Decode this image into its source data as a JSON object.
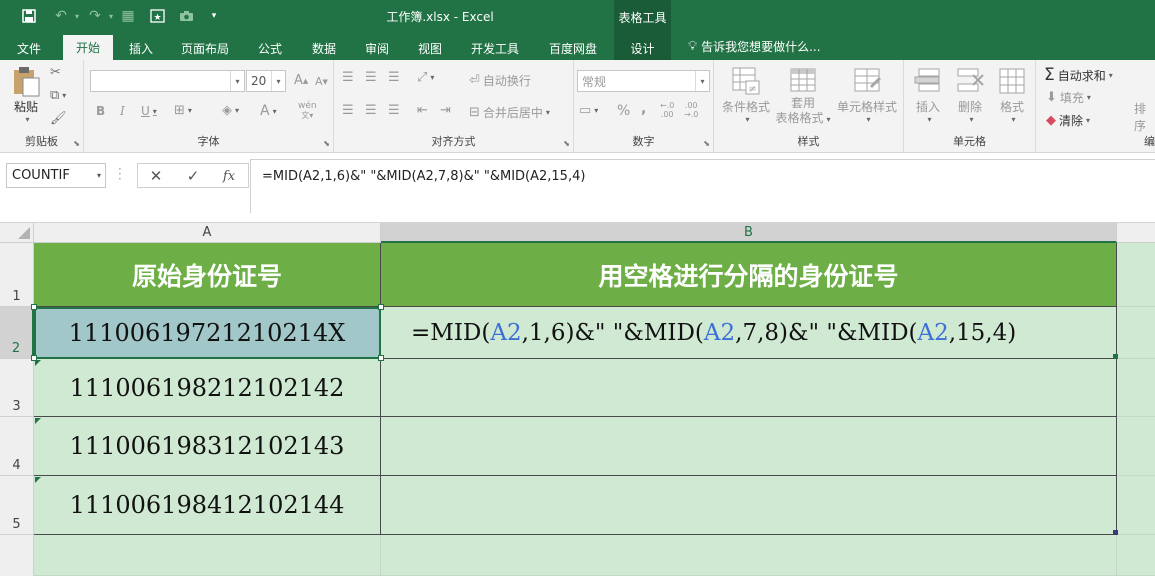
{
  "window": {
    "title": "工作簿.xlsx - Excel",
    "context_group": "表格工具"
  },
  "tabs": [
    {
      "label": "文件"
    },
    {
      "label": "开始"
    },
    {
      "label": "插入"
    },
    {
      "label": "页面布局"
    },
    {
      "label": "公式"
    },
    {
      "label": "数据"
    },
    {
      "label": "审阅"
    },
    {
      "label": "视图"
    },
    {
      "label": "开发工具"
    },
    {
      "label": "百度网盘"
    },
    {
      "label": "设计"
    }
  ],
  "tell_me": "告诉我您想要做什么...",
  "ribbon": {
    "clipboard": {
      "label": "剪贴板",
      "paste": "粘贴"
    },
    "font": {
      "label": "字体",
      "font_name": "",
      "font_size": "20",
      "bold": "B",
      "italic": "I",
      "underline": "U",
      "grow": "A",
      "shrink": "A"
    },
    "alignment": {
      "label": "对齐方式",
      "wrap": "自动换行",
      "merge": "合并后居中"
    },
    "number": {
      "label": "数字",
      "format": "常规",
      "percent": "%",
      "comma": ","
    },
    "styles": {
      "label": "样式",
      "conditional": "条件格式",
      "table_format_1": "套用",
      "table_format_2": "表格格式",
      "cell_styles": "单元格样式"
    },
    "cells": {
      "label": "单元格",
      "insert": "插入",
      "delete": "删除",
      "format": "格式"
    },
    "editing": {
      "label": "编",
      "autosum": "自动求和",
      "fill": "填充",
      "clear": "清除",
      "sort": "排序"
    }
  },
  "formula_bar": {
    "name_box": "COUNTIF",
    "cancel": "✕",
    "enter": "✓",
    "fx": "fx",
    "formula": "=MID(A2,1,6)&\" \"&MID(A2,7,8)&\" \"&MID(A2,15,4)"
  },
  "sheet": {
    "columns": [
      "A",
      "B"
    ],
    "rows": [
      "1",
      "2",
      "3",
      "4",
      "5"
    ],
    "header_a": "原始身份证号",
    "header_b": "用空格进行分隔的身份证号",
    "ids": [
      "11100619721210214X",
      "111006198212102142",
      "111006198312102143",
      "111006198412102144"
    ],
    "b2_formula": {
      "p1": "=MID(",
      "r1": "A2",
      "p2": ",1,6)&\" \"&MID(",
      "r2": "A2",
      "p3": ",7,8)&\" \"&MID(",
      "r3": "A2",
      "p4": ",15,4)"
    }
  },
  "colors": {
    "brand": "#217346",
    "header_fill": "#6daf46",
    "cell_fill": "#d0e9d3",
    "ref_color": "#3b70d6"
  }
}
